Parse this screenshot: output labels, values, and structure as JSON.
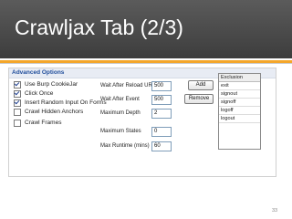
{
  "slide": {
    "title": "Crawljax Tab (2/3)",
    "page_number": "33"
  },
  "panel": {
    "header": "Advanced Options",
    "options": [
      {
        "label": "Use Burp CookieJar",
        "checked": true
      },
      {
        "label": "Click Once",
        "checked": true
      },
      {
        "label": "Insert Random Input On Forms",
        "checked": true
      },
      {
        "label": "Crawl Hidden Anchors",
        "checked": false
      },
      {
        "label": "Crawl Frames",
        "checked": false
      }
    ],
    "fields": {
      "wait_after_reload_label": "Wait After Reload URL",
      "wait_after_reload_value": "500",
      "wait_after_event_label": "Wait After Event",
      "wait_after_event_value": "500",
      "max_depth_label": "Maximum Depth",
      "max_depth_value": "2",
      "max_states_label": "Maximum States",
      "max_states_value": "0",
      "max_runtime_label": "Max Runtime (mins)",
      "max_runtime_value": "60"
    },
    "buttons": {
      "add": "Add",
      "remove": "Remove"
    },
    "exclusion": {
      "header": "Exclusion",
      "items": [
        "exit",
        "signout",
        "signoff",
        "logoff",
        "logout"
      ]
    }
  }
}
